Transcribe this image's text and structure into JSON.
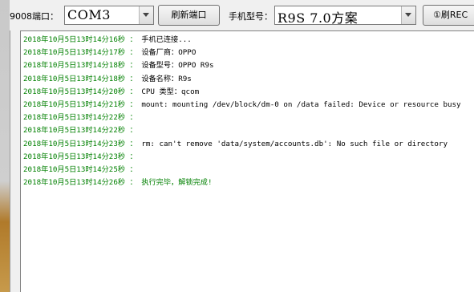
{
  "toolbar": {
    "port_label": "9008端口：",
    "port_value": "COM3",
    "refresh_button": "刷新端口",
    "model_label": "手机型号：",
    "model_value": "R9S 7.0方案",
    "flash_button": "①刷REC"
  },
  "log": [
    {
      "ts": "2018年10月5日13时14分16秒",
      "msg": "手机已连接..."
    },
    {
      "ts": "2018年10月5日13时14分17秒",
      "msg": "设备厂商：OPPO"
    },
    {
      "ts": "2018年10月5日13时14分18秒",
      "msg": "设备型号：OPPO R9s"
    },
    {
      "ts": "2018年10月5日13时14分18秒",
      "msg": "设备名称：R9s"
    },
    {
      "ts": "2018年10月5日13时14分20秒",
      "msg": "CPU 类型：qcom"
    },
    {
      "ts": "2018年10月5日13时14分21秒",
      "msg": "mount: mounting /dev/block/dm-0 on /data failed: Device or resource busy"
    },
    {
      "ts": "2018年10月5日13时14分22秒",
      "msg": ""
    },
    {
      "ts": "2018年10月5日13时14分22秒",
      "msg": ""
    },
    {
      "ts": "2018年10月5日13时14分23秒",
      "msg": "rm: can't remove 'data/system/accounts.db': No such file or directory"
    },
    {
      "ts": "2018年10月5日13时14分23秒",
      "msg": ""
    },
    {
      "ts": "2018年10月5日13时14分25秒",
      "msg": ""
    },
    {
      "ts": "2018年10月5日13时14分26秒",
      "msg": "执行完毕，解锁完成!"
    }
  ],
  "log_separator": " ： ",
  "colors": {
    "timestamp": "#008000",
    "message": "#000000",
    "success": "#008000"
  }
}
